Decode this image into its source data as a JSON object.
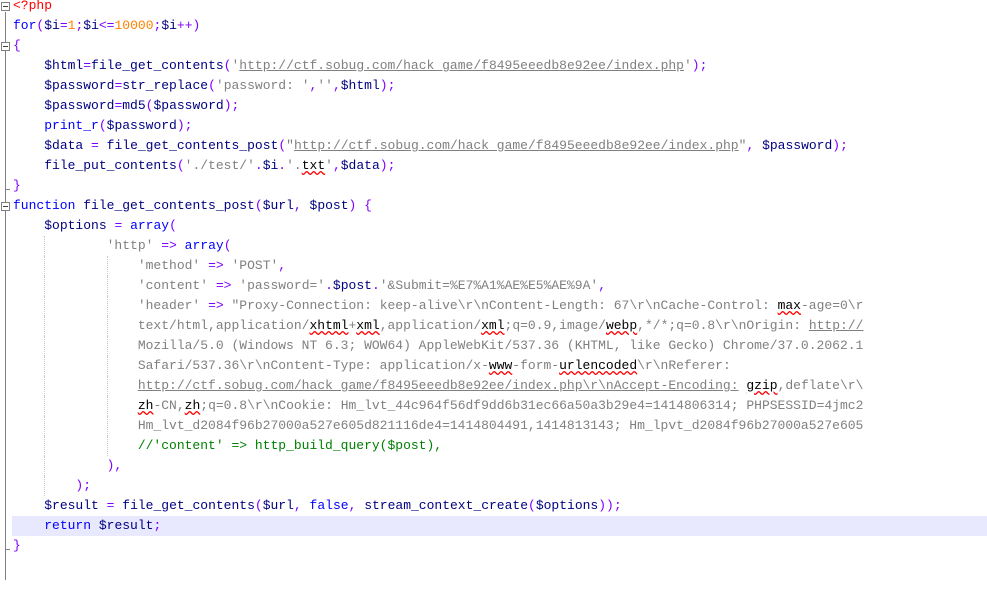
{
  "editor": {
    "lines": [
      [
        [
          "php",
          "<?php"
        ]
      ],
      [
        [
          "kw",
          "for"
        ],
        [
          "op",
          "("
        ],
        [
          "var",
          "$i"
        ],
        [
          "op",
          "="
        ],
        [
          "num",
          "1"
        ],
        [
          "op",
          ";"
        ],
        [
          "var",
          "$i"
        ],
        [
          "op",
          "<="
        ],
        [
          "num",
          "10000"
        ],
        [
          "op",
          ";"
        ],
        [
          "var",
          "$i"
        ],
        [
          "op",
          "++)"
        ]
      ],
      [
        [
          "op",
          "{"
        ]
      ],
      [
        [
          "txt",
          "    "
        ],
        [
          "var",
          "$html"
        ],
        [
          "op",
          "="
        ],
        [
          "fn",
          "file_get_contents"
        ],
        [
          "op",
          "("
        ],
        [
          "str",
          "'"
        ],
        [
          "link",
          "http://ctf.sobug.com/hack_game/f8495eeedb8e92ee/index.php"
        ],
        [
          "str",
          "'"
        ],
        [
          "op",
          ");"
        ]
      ],
      [
        [
          "txt",
          "    "
        ],
        [
          "var",
          "$password"
        ],
        [
          "op",
          "="
        ],
        [
          "fn",
          "str_replace"
        ],
        [
          "op",
          "("
        ],
        [
          "str",
          "'password: '"
        ],
        [
          "op",
          ","
        ],
        [
          "str",
          "''"
        ],
        [
          "op",
          ","
        ],
        [
          "var",
          "$html"
        ],
        [
          "op",
          ");"
        ]
      ],
      [
        [
          "txt",
          "    "
        ],
        [
          "var",
          "$password"
        ],
        [
          "op",
          "="
        ],
        [
          "fn",
          "md5"
        ],
        [
          "op",
          "("
        ],
        [
          "var",
          "$password"
        ],
        [
          "op",
          ");"
        ]
      ],
      [
        [
          "txt",
          "    "
        ],
        [
          "kw",
          "print_r"
        ],
        [
          "op",
          "("
        ],
        [
          "var",
          "$password"
        ],
        [
          "op",
          ");"
        ]
      ],
      [
        [
          "txt",
          "    "
        ],
        [
          "var",
          "$data"
        ],
        [
          "txt",
          " "
        ],
        [
          "op",
          "="
        ],
        [
          "txt",
          " "
        ],
        [
          "fn",
          "file_get_contents_post"
        ],
        [
          "op",
          "("
        ],
        [
          "str",
          "\""
        ],
        [
          "link",
          "http://ctf.sobug.com/hack_game/f8495eeedb8e92ee/index.php"
        ],
        [
          "str",
          "\""
        ],
        [
          "op",
          ","
        ],
        [
          "txt",
          " "
        ],
        [
          "var",
          "$password"
        ],
        [
          "op",
          ");"
        ]
      ],
      [
        [
          "txt",
          "    "
        ],
        [
          "fn",
          "file_put_contents"
        ],
        [
          "op",
          "("
        ],
        [
          "str",
          "'./test/'"
        ],
        [
          "op",
          "."
        ],
        [
          "var",
          "$i"
        ],
        [
          "op",
          "."
        ],
        [
          "str",
          "'."
        ],
        [
          "sq",
          "txt"
        ],
        [
          "str",
          "'"
        ],
        [
          "op",
          ","
        ],
        [
          "var",
          "$data"
        ],
        [
          "op",
          ");"
        ]
      ],
      [
        [
          "op",
          "}"
        ]
      ],
      [
        [
          "kw",
          "function"
        ],
        [
          "txt",
          " "
        ],
        [
          "fn",
          "file_get_contents_post"
        ],
        [
          "op",
          "("
        ],
        [
          "var",
          "$url"
        ],
        [
          "op",
          ","
        ],
        [
          "txt",
          " "
        ],
        [
          "var",
          "$post"
        ],
        [
          "op",
          ")"
        ],
        [
          "txt",
          " "
        ],
        [
          "op",
          "{"
        ]
      ],
      [
        [
          "txt",
          "    "
        ],
        [
          "var",
          "$options"
        ],
        [
          "txt",
          " "
        ],
        [
          "op",
          "="
        ],
        [
          "txt",
          " "
        ],
        [
          "kw",
          "array"
        ],
        [
          "op",
          "("
        ]
      ],
      [
        [
          "txt",
          "            "
        ],
        [
          "str",
          "'http'"
        ],
        [
          "txt",
          " "
        ],
        [
          "op",
          "=>"
        ],
        [
          "txt",
          " "
        ],
        [
          "kw",
          "array"
        ],
        [
          "op",
          "("
        ]
      ],
      [
        [
          "txt",
          "                "
        ],
        [
          "str",
          "'method'"
        ],
        [
          "txt",
          " "
        ],
        [
          "op",
          "=>"
        ],
        [
          "txt",
          " "
        ],
        [
          "str",
          "'POST'"
        ],
        [
          "op",
          ","
        ]
      ],
      [
        [
          "txt",
          "                "
        ],
        [
          "str",
          "'content'"
        ],
        [
          "txt",
          " "
        ],
        [
          "op",
          "=>"
        ],
        [
          "txt",
          " "
        ],
        [
          "str",
          "'password='"
        ],
        [
          "op",
          "."
        ],
        [
          "var",
          "$post"
        ],
        [
          "op",
          "."
        ],
        [
          "str",
          "'&Submit=%E7%A1%AE%E5%AE%9A'"
        ],
        [
          "op",
          ","
        ]
      ],
      [
        [
          "txt",
          "                "
        ],
        [
          "str",
          "'header'"
        ],
        [
          "txt",
          " "
        ],
        [
          "op",
          "=>"
        ],
        [
          "txt",
          " "
        ],
        [
          "str",
          "\"Proxy-Connection: keep-alive\\r\\nContent-Length: 67\\r\\nCache-Control: "
        ],
        [
          "sq",
          "max"
        ],
        [
          "str",
          "-age=0\\r"
        ]
      ],
      [
        [
          "txt",
          "                "
        ],
        [
          "str",
          "text/html,application/"
        ],
        [
          "sq",
          "xhtml"
        ],
        [
          "str",
          "+"
        ],
        [
          "sq",
          "xml"
        ],
        [
          "str",
          ",application/"
        ],
        [
          "sq",
          "xml"
        ],
        [
          "str",
          ";q=0.9,image/"
        ],
        [
          "sq",
          "webp"
        ],
        [
          "str",
          ",*/*;q=0.8\\r\\nOrigin: "
        ],
        [
          "link",
          "http://"
        ]
      ],
      [
        [
          "txt",
          "                "
        ],
        [
          "str",
          "Mozilla/5.0 (Windows NT 6.3; WOW64) AppleWebKit/537.36 (KHTML, like Gecko) Chrome/37.0.2062.1"
        ]
      ],
      [
        [
          "txt",
          "                "
        ],
        [
          "str",
          "Safari/537.36\\r\\nContent-Type: application/x-"
        ],
        [
          "sq",
          "www"
        ],
        [
          "str",
          "-form-"
        ],
        [
          "sq",
          "urlencoded"
        ],
        [
          "str",
          "\\r\\nReferer:"
        ]
      ],
      [
        [
          "txt",
          "                "
        ],
        [
          "link",
          "http://ctf.sobug.com/hack_game/f8495eeedb8e92ee/index.php\\r\\nAccept-Encoding:"
        ],
        [
          "str",
          " "
        ],
        [
          "sq",
          "gzip"
        ],
        [
          "str",
          ",deflate\\r\\"
        ]
      ],
      [
        [
          "txt",
          "                "
        ],
        [
          "sq",
          "zh"
        ],
        [
          "str",
          "-CN,"
        ],
        [
          "sq",
          "zh"
        ],
        [
          "str",
          ";q=0.8\\r\\nCookie: Hm_lvt_44c964f56df9dd6b31ec66a50a3b29e4=1414806314; PHPSESSID=4jmc2"
        ]
      ],
      [
        [
          "txt",
          "                "
        ],
        [
          "str",
          "Hm_lvt_d2084f96b27000a527e605d821116de4=1414804491,1414813143; Hm_lpvt_d2084f96b27000a527e605"
        ]
      ],
      [
        [
          "txt",
          "                "
        ],
        [
          "com",
          "//'content' => http_build_query($post),"
        ]
      ],
      [
        [
          "txt",
          "            "
        ],
        [
          "op",
          "),"
        ]
      ],
      [
        [
          "txt",
          "        "
        ],
        [
          "op",
          ");"
        ]
      ],
      [
        [
          "txt",
          "    "
        ],
        [
          "var",
          "$result"
        ],
        [
          "txt",
          " "
        ],
        [
          "op",
          "="
        ],
        [
          "txt",
          " "
        ],
        [
          "fn",
          "file_get_contents"
        ],
        [
          "op",
          "("
        ],
        [
          "var",
          "$url"
        ],
        [
          "op",
          ","
        ],
        [
          "txt",
          " "
        ],
        [
          "kw",
          "false"
        ],
        [
          "op",
          ","
        ],
        [
          "txt",
          " "
        ],
        [
          "fn",
          "stream_context_create"
        ],
        [
          "op",
          "("
        ],
        [
          "var",
          "$options"
        ],
        [
          "op",
          "));"
        ]
      ],
      [
        [
          "txt",
          "    "
        ],
        [
          "kw",
          "return"
        ],
        [
          "txt",
          " "
        ],
        [
          "var",
          "$result"
        ],
        [
          "op",
          ";"
        ]
      ],
      [
        [
          "op",
          "}"
        ]
      ]
    ]
  }
}
